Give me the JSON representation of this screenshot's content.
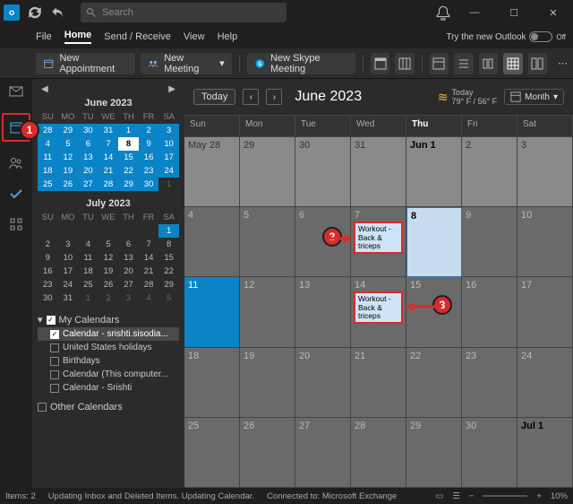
{
  "titlebar": {
    "search_placeholder": "Search"
  },
  "menubar": {
    "file": "File",
    "home": "Home",
    "sendreceive": "Send / Receive",
    "view": "View",
    "help": "Help",
    "try_new": "Try the new Outlook",
    "toggle": "Off"
  },
  "toolbar": {
    "new_appt": "New Appointment",
    "new_meeting": "New Meeting",
    "new_skype": "New Skype Meeting"
  },
  "leftrail_badge": "1",
  "sidebar": {
    "mini1": {
      "title": "June 2023",
      "dow": [
        "SU",
        "MO",
        "TU",
        "WE",
        "TH",
        "FR",
        "SA"
      ],
      "rows": [
        [
          {
            "d": "28",
            "c": "cur"
          },
          {
            "d": "29",
            "c": "cur"
          },
          {
            "d": "30",
            "c": "cur"
          },
          {
            "d": "31",
            "c": "cur"
          },
          {
            "d": "1",
            "c": "cur"
          },
          {
            "d": "2",
            "c": "cur"
          },
          {
            "d": "3",
            "c": "cur"
          }
        ],
        [
          {
            "d": "4",
            "c": "cur"
          },
          {
            "d": "5",
            "c": "cur"
          },
          {
            "d": "6",
            "c": "cur"
          },
          {
            "d": "7",
            "c": "cur"
          },
          {
            "d": "8",
            "c": "today"
          },
          {
            "d": "9",
            "c": "cur"
          },
          {
            "d": "10",
            "c": "cur"
          }
        ],
        [
          {
            "d": "11",
            "c": "cur"
          },
          {
            "d": "12",
            "c": "cur"
          },
          {
            "d": "13",
            "c": "cur"
          },
          {
            "d": "14",
            "c": "cur"
          },
          {
            "d": "15",
            "c": "cur"
          },
          {
            "d": "16",
            "c": "cur"
          },
          {
            "d": "17",
            "c": "cur"
          }
        ],
        [
          {
            "d": "18",
            "c": "cur"
          },
          {
            "d": "19",
            "c": "cur"
          },
          {
            "d": "20",
            "c": "cur"
          },
          {
            "d": "21",
            "c": "cur"
          },
          {
            "d": "22",
            "c": "cur"
          },
          {
            "d": "23",
            "c": "cur"
          },
          {
            "d": "24",
            "c": "cur"
          }
        ],
        [
          {
            "d": "25",
            "c": "cur"
          },
          {
            "d": "26",
            "c": "cur"
          },
          {
            "d": "27",
            "c": "cur"
          },
          {
            "d": "28",
            "c": "cur"
          },
          {
            "d": "29",
            "c": "cur"
          },
          {
            "d": "30",
            "c": "cur"
          },
          {
            "d": "1",
            "c": "off"
          }
        ]
      ]
    },
    "mini2": {
      "title": "July 2023",
      "dow": [
        "SU",
        "MO",
        "TU",
        "WE",
        "TH",
        "FR",
        "SA"
      ],
      "rows": [
        [
          {
            "d": "",
            "c": "off"
          },
          {
            "d": "",
            "c": "off"
          },
          {
            "d": "",
            "c": "off"
          },
          {
            "d": "",
            "c": "off"
          },
          {
            "d": "",
            "c": "off"
          },
          {
            "d": "",
            "c": "off"
          },
          {
            "d": "1",
            "c": "cur"
          }
        ],
        [
          {
            "d": "2"
          },
          {
            "d": "3"
          },
          {
            "d": "4"
          },
          {
            "d": "5"
          },
          {
            "d": "6"
          },
          {
            "d": "7"
          },
          {
            "d": "8"
          }
        ],
        [
          {
            "d": "9"
          },
          {
            "d": "10"
          },
          {
            "d": "11"
          },
          {
            "d": "12"
          },
          {
            "d": "13"
          },
          {
            "d": "14"
          },
          {
            "d": "15"
          }
        ],
        [
          {
            "d": "16"
          },
          {
            "d": "17"
          },
          {
            "d": "18"
          },
          {
            "d": "19"
          },
          {
            "d": "20"
          },
          {
            "d": "21"
          },
          {
            "d": "22"
          }
        ],
        [
          {
            "d": "23"
          },
          {
            "d": "24"
          },
          {
            "d": "25"
          },
          {
            "d": "26"
          },
          {
            "d": "27"
          },
          {
            "d": "28"
          },
          {
            "d": "29"
          }
        ],
        [
          {
            "d": "30"
          },
          {
            "d": "31"
          },
          {
            "d": "1",
            "c": "off"
          },
          {
            "d": "2",
            "c": "off"
          },
          {
            "d": "3",
            "c": "off"
          },
          {
            "d": "4",
            "c": "off"
          },
          {
            "d": "5",
            "c": "off"
          }
        ]
      ]
    },
    "groups": {
      "my": "My Calendars",
      "items": [
        {
          "label": "Calendar - srishti.sisodia...",
          "on": true,
          "sel": true
        },
        {
          "label": "United States holidays",
          "on": false
        },
        {
          "label": "Birthdays",
          "on": false
        },
        {
          "label": "Calendar (This computer...",
          "on": false
        },
        {
          "label": "Calendar - Srishti",
          "on": false
        }
      ],
      "other": "Other Calendars"
    }
  },
  "calhead": {
    "today": "Today",
    "title": "June 2023",
    "weather_today": "Today",
    "weather_temp": "79° F / 56° F",
    "month": "Month"
  },
  "dow": [
    "Sun",
    "Mon",
    "Tue",
    "Wed",
    "Thu",
    "Fri",
    "Sat"
  ],
  "weeks": [
    [
      {
        "d": "May 28",
        "cls": "light"
      },
      {
        "d": "29",
        "cls": "light"
      },
      {
        "d": "30",
        "cls": "light"
      },
      {
        "d": "31",
        "cls": "light"
      },
      {
        "d": "Jun 1",
        "cls": "light",
        "bold": true
      },
      {
        "d": "2",
        "cls": "light"
      },
      {
        "d": "3",
        "cls": "light"
      }
    ],
    [
      {
        "d": "4"
      },
      {
        "d": "5"
      },
      {
        "d": "6"
      },
      {
        "d": "7",
        "evt": "Workout - Back & triceps",
        "red": true,
        "badge": "2"
      },
      {
        "d": "8",
        "cls": "today",
        "bold": true
      },
      {
        "d": "9"
      },
      {
        "d": "10"
      }
    ],
    [
      {
        "d": "11",
        "cls": "sel"
      },
      {
        "d": "12"
      },
      {
        "d": "13"
      },
      {
        "d": "14",
        "evt": "Workout - Back & triceps",
        "red": true,
        "badge": "3",
        "arrow": true
      },
      {
        "d": "15"
      },
      {
        "d": "16"
      },
      {
        "d": "17"
      }
    ],
    [
      {
        "d": "18"
      },
      {
        "d": "19"
      },
      {
        "d": "20"
      },
      {
        "d": "21"
      },
      {
        "d": "22"
      },
      {
        "d": "23"
      },
      {
        "d": "24"
      }
    ],
    [
      {
        "d": "25"
      },
      {
        "d": "26"
      },
      {
        "d": "27"
      },
      {
        "d": "28"
      },
      {
        "d": "29"
      },
      {
        "d": "30"
      },
      {
        "d": "Jul 1",
        "bold": true
      }
    ]
  ],
  "status": {
    "items": "Items: 2",
    "updating": "Updating Inbox and Deleted Items.  Updating Calendar.",
    "connected": "Connected to: Microsoft Exchange",
    "zoom": "10%"
  }
}
